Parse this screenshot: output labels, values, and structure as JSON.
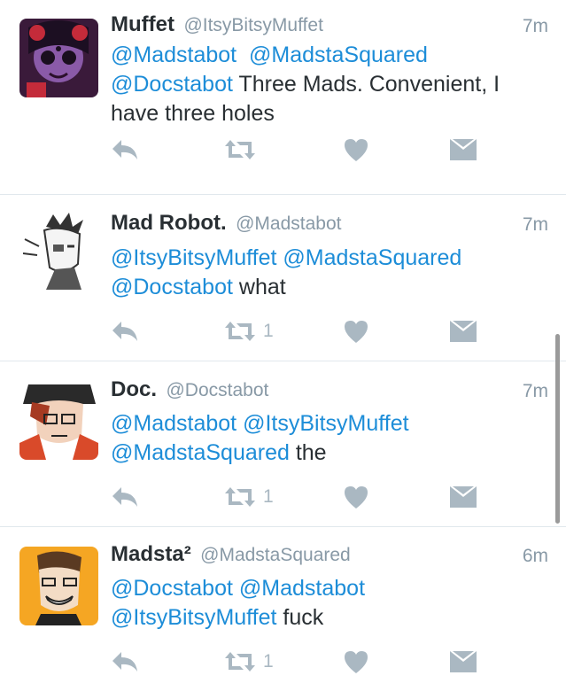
{
  "colors": {
    "mention": "#1d8dd8",
    "text": "#292f33",
    "meta": "#8899a6",
    "icon": "#aab8c2"
  },
  "tweets": [
    {
      "name": "Muffet",
      "handle": "@ItsyBitsyMuffet",
      "time": "7m",
      "lines": [
        {
          "mentions": [
            "@Madstabot",
            "@MadstaSquared"
          ],
          "text": ""
        },
        {
          "mentions": [
            "@Docstabot"
          ],
          "text": " Three Mads. Convenient, I"
        },
        {
          "mentions": [],
          "text": "have three holes"
        }
      ],
      "retweet_count": "",
      "avatar_icon": "spider-girl-avatar"
    },
    {
      "name": "Mad Robot.",
      "handle": "@Madstabot",
      "time": "7m",
      "lines": [
        {
          "mentions": [
            "@ItsyBitsyMuffet",
            "@MadstaSquared"
          ],
          "text": ""
        },
        {
          "mentions": [
            "@Docstabot"
          ],
          "text": " what"
        }
      ],
      "retweet_count": "1",
      "avatar_icon": "sketch-robot-avatar"
    },
    {
      "name": "Doc.",
      "handle": "@Docstabot",
      "time": "7m",
      "lines": [
        {
          "mentions": [
            "@Madstabot",
            "@ItsyBitsyMuffet"
          ],
          "text": ""
        },
        {
          "mentions": [
            "@MadstaSquared"
          ],
          "text": " the"
        }
      ],
      "retweet_count": "1",
      "avatar_icon": "doctor-avatar"
    },
    {
      "name": "Madsta²",
      "handle": "@MadstaSquared",
      "time": "6m",
      "lines": [
        {
          "mentions": [
            "@Docstabot",
            "@Madstabot"
          ],
          "text": ""
        },
        {
          "mentions": [
            "@ItsyBitsyMuffet"
          ],
          "text": " fuck"
        }
      ],
      "retweet_count": "1",
      "avatar_icon": "grinning-man-avatar"
    }
  ]
}
